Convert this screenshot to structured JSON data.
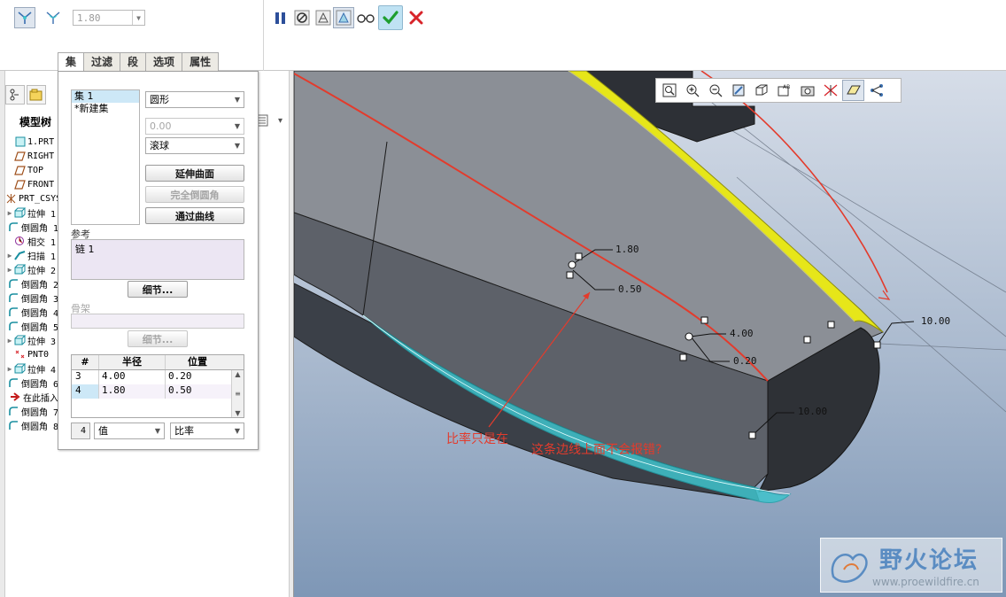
{
  "dashboard": {
    "radius_value": "1.80",
    "left_icons": [
      "variable-radius-round-icon",
      "conic-round-icon"
    ],
    "right_icons": [
      "pause-icon",
      "no-preview-icon",
      "static-preview-icon",
      "dynamic-preview-icon",
      "verify-glasses-icon",
      "ok-check-icon",
      "cancel-x-icon"
    ]
  },
  "tabs": [
    "集",
    "过滤",
    "段",
    "选项",
    "属性"
  ],
  "model_tree": {
    "title": "模型树",
    "items": [
      {
        "label": "1.PRT",
        "icon": "part-icon",
        "expand": ""
      },
      {
        "label": "RIGHT",
        "icon": "datum-plane-icon",
        "expand": ""
      },
      {
        "label": "TOP",
        "icon": "datum-plane-icon",
        "expand": ""
      },
      {
        "label": "FRONT",
        "icon": "datum-plane-icon",
        "expand": ""
      },
      {
        "label": "PRT_CSYS_DEF",
        "icon": "csys-icon",
        "expand": ""
      },
      {
        "label": "拉伸 1",
        "icon": "extrude-icon",
        "expand": "▶"
      },
      {
        "label": "倒圆角 1",
        "icon": "round-icon",
        "expand": ""
      },
      {
        "label": "相交 1",
        "icon": "intersect-icon",
        "expand": ""
      },
      {
        "label": "扫描 1",
        "icon": "sweep-icon",
        "expand": "▶"
      },
      {
        "label": "拉伸 2",
        "icon": "extrude-icon",
        "expand": "▶"
      },
      {
        "label": "倒圆角 2",
        "icon": "round-icon",
        "expand": ""
      },
      {
        "label": "倒圆角 3",
        "icon": "round-icon",
        "expand": ""
      },
      {
        "label": "倒圆角 4",
        "icon": "round-icon",
        "expand": ""
      },
      {
        "label": "倒圆角 5",
        "icon": "round-icon",
        "expand": ""
      },
      {
        "label": "拉伸 3",
        "icon": "extrude-icon",
        "expand": "▶"
      },
      {
        "label": "PNT0",
        "icon": "datum-point-icon",
        "expand": ""
      },
      {
        "label": "拉伸 4",
        "icon": "extrude-icon",
        "expand": "▶"
      },
      {
        "label": "倒圆角 6",
        "icon": "round-icon",
        "expand": ""
      },
      {
        "label": "在此插入",
        "icon": "insert-arrow-icon",
        "expand": ""
      },
      {
        "label": "倒圆角 7",
        "icon": "round-icon",
        "expand": ""
      },
      {
        "label": "倒圆角 8",
        "icon": "round-icon",
        "expand": ""
      }
    ]
  },
  "sets_panel": {
    "sets": [
      "集 1",
      "*新建集"
    ],
    "shape_select": "圆形",
    "distance_value": "0.00",
    "method_select": "滚球",
    "btn_extend": "延伸曲面",
    "btn_full_round": "完全倒圆角",
    "btn_through_curve": "通过曲线",
    "ref_label": "参考",
    "ref_item": "链 1",
    "details_btn": "细节...",
    "skeleton_label": "骨架",
    "skeleton_details_btn": "细节...",
    "table_header": [
      "#",
      "半径",
      "位置"
    ],
    "table_rows": [
      {
        "num": "3",
        "radius": "4.00",
        "pos": "0.20"
      },
      {
        "num": "4",
        "radius": "1.80",
        "pos": "0.50"
      }
    ],
    "footer_num": "4",
    "footer_value_select": "值",
    "footer_ratio_select": "比率"
  },
  "view_toolbar_icons": [
    "refit-icon",
    "zoom-in-icon",
    "zoom-out-icon",
    "repaint-icon",
    "display-style-icon",
    "saved-views-icon",
    "layers-icon",
    "datum-display-icon",
    "datum-planes-icon",
    "datum-points-icon"
  ],
  "graphics": {
    "dims": [
      "1.80",
      "0.50",
      "4.00",
      "0.20",
      "10.00",
      "10.00"
    ],
    "annotation_1": "比率只是在",
    "annotation_2": "这条边线上面不会报错?"
  },
  "watermark": {
    "title": "野火论坛",
    "url": "www.proewildfire.cn"
  },
  "colors": {
    "accent_red": "#e33b2c",
    "highlight_yellow": "#e6e619",
    "preview_cyan": "#3fc3cc",
    "ok_green": "#1e9e2e",
    "cancel_red": "#d8242a"
  }
}
